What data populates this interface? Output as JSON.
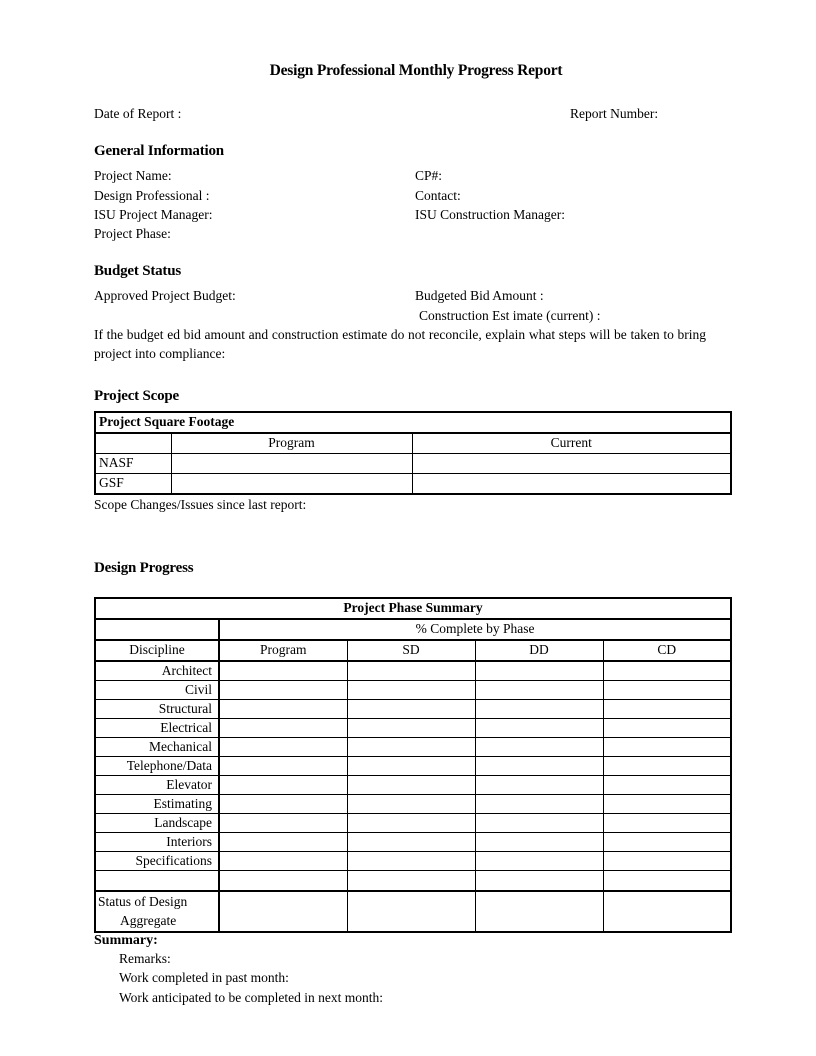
{
  "document": {
    "title": "Design Professional Monthly Progress Report",
    "date_of_report_label": "Date of Report :",
    "report_number_label": "Report Number:"
  },
  "general_information": {
    "heading": "General Information",
    "fields_left": [
      "Project Name:",
      "Design  Professional :",
      "ISU Project Manager:",
      "Project Phase:"
    ],
    "fields_right": [
      "CP#:",
      "Contact:",
      "ISU Construction Manager:",
      ""
    ]
  },
  "budget_status": {
    "heading": "Budget Status",
    "approved_project_budget_label": "Approved Project Budget:",
    "budgeted_bid_amount_label": "Budgeted Bid Amount  :",
    "construction_estimate_label": "Construction Est imate  (current) :",
    "reconcile_text": "If the budget ed bid amount  and construction  estimate  do not reconcile,  explain what  steps will be taken to  bring project into compliance:"
  },
  "project_scope": {
    "heading": "Project Scope",
    "table": {
      "caption": "Project Square Footage",
      "columns": [
        "",
        "Program",
        "Current"
      ],
      "rows": [
        {
          "label": "NASF",
          "program": "",
          "current": ""
        },
        {
          "label": "GSF",
          "program": "",
          "current": ""
        }
      ]
    },
    "scope_changes_label": "Scope Changes/Issues since last report:"
  },
  "design_progress": {
    "heading": "Design Progress",
    "table": {
      "title": "Project Phase Summary",
      "group_header": "% Complete by Phase",
      "columns": [
        "Discipline",
        "Program",
        "SD",
        "DD",
        "CD"
      ],
      "rows": [
        {
          "discipline": "Architect",
          "program": "",
          "sd": "",
          "dd": "",
          "cd": ""
        },
        {
          "discipline": "Civil",
          "program": "",
          "sd": "",
          "dd": "",
          "cd": ""
        },
        {
          "discipline": "Structural",
          "program": "",
          "sd": "",
          "dd": "",
          "cd": ""
        },
        {
          "discipline": "Electrical",
          "program": "",
          "sd": "",
          "dd": "",
          "cd": ""
        },
        {
          "discipline": "Mechanical",
          "program": "",
          "sd": "",
          "dd": "",
          "cd": ""
        },
        {
          "discipline": "Telephone/Data",
          "program": "",
          "sd": "",
          "dd": "",
          "cd": ""
        },
        {
          "discipline": "Elevator",
          "program": "",
          "sd": "",
          "dd": "",
          "cd": ""
        },
        {
          "discipline": "Estimating",
          "program": "",
          "sd": "",
          "dd": "",
          "cd": ""
        },
        {
          "discipline": "Landscape",
          "program": "",
          "sd": "",
          "dd": "",
          "cd": ""
        },
        {
          "discipline": "Interiors",
          "program": "",
          "sd": "",
          "dd": "",
          "cd": ""
        },
        {
          "discipline": "Specifications",
          "program": "",
          "sd": "",
          "dd": "",
          "cd": ""
        }
      ],
      "spacer_row": {
        "discipline": "",
        "program": "",
        "sd": "",
        "dd": "",
        "cd": ""
      },
      "status_row": {
        "label_line1": "Status of Design",
        "label_line2": "Aggregate",
        "program": "",
        "sd": "",
        "dd": "",
        "cd": ""
      }
    }
  },
  "summary": {
    "heading": "Summary:",
    "items": [
      "Remarks:",
      "Work completed in past month:",
      "Work anticipated to be completed in next month:"
    ]
  }
}
